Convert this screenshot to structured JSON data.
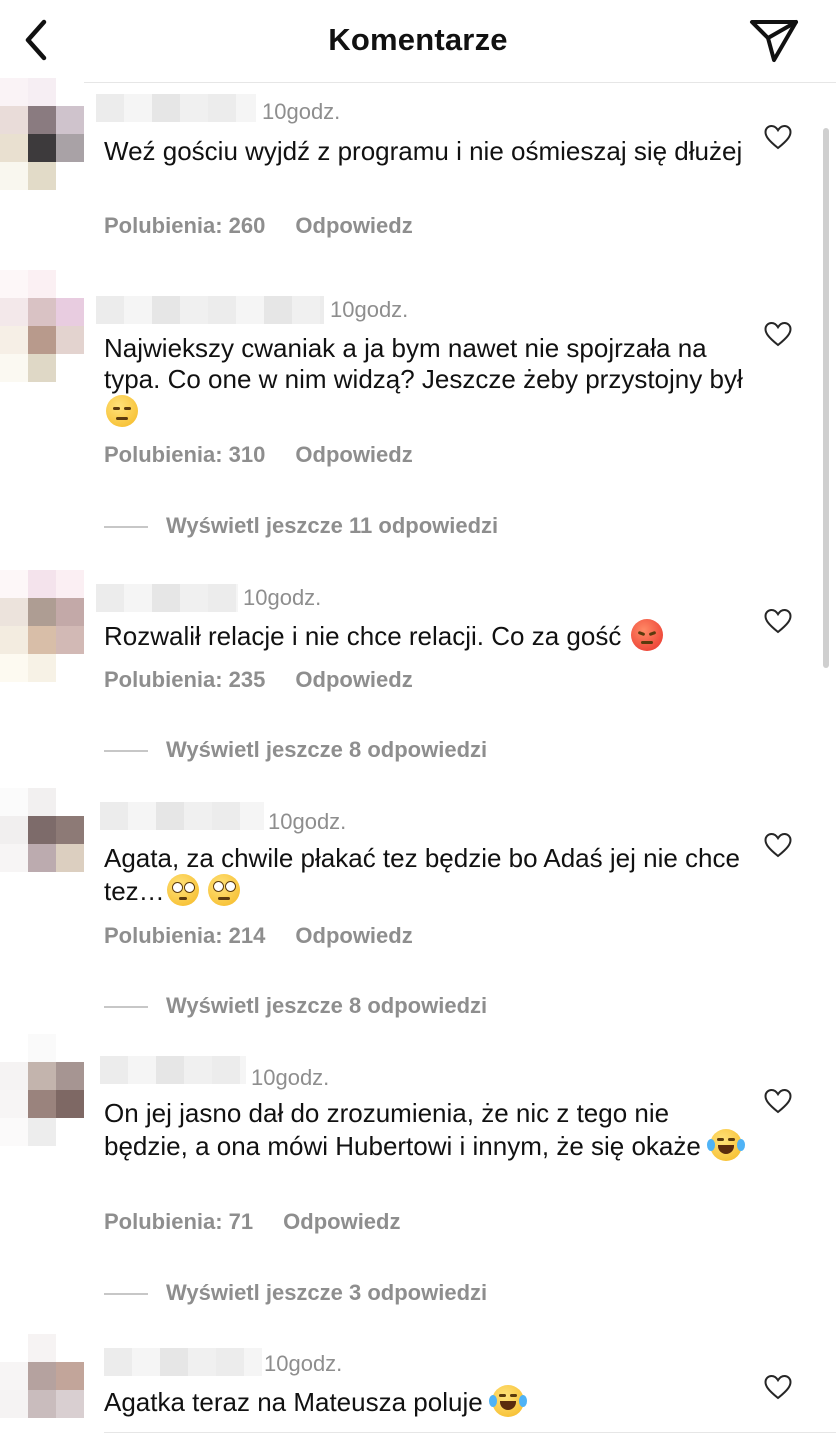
{
  "header": {
    "title": "Komentarze",
    "back_icon": "chevron-left-icon",
    "send_icon": "paper-plane-icon"
  },
  "comments": [
    {
      "time": "10godz.",
      "text": "Weź gościu wyjdź z programu i nie ośmieszaj się dłużej",
      "likes": "Polubienia: 260",
      "reply": "Odpowiedz"
    },
    {
      "time": "10godz.",
      "text": "Najwiekszy cwaniak a ja bym nawet nie spojrzała na typa. Co one w nim widzą? Jeszcze żeby przystojny był",
      "emoji": [
        "unamused-face"
      ],
      "likes": "Polubienia: 310",
      "reply": "Odpowiedz",
      "more_replies": "Wyświetl jeszcze 11 odpowiedzi"
    },
    {
      "time": "10godz.",
      "text": "Rozwalił relacje i nie chce relacji. Co za gość",
      "emoji": [
        "pouting-face"
      ],
      "likes": "Polubienia: 235",
      "reply": "Odpowiedz",
      "more_replies": "Wyświetl jeszcze 8 odpowiedzi"
    },
    {
      "time": "10godz.",
      "text": "Agata, za chwile płakać tez będzie bo Adaś jej nie chce tez…",
      "emoji": [
        "flushed-face",
        "face-with-rolling-eyes"
      ],
      "likes": "Polubienia: 214",
      "reply": "Odpowiedz",
      "more_replies": "Wyświetl jeszcze 8 odpowiedzi"
    },
    {
      "time": "10godz.",
      "text": "On jej jasno dał do zrozumienia, że nic z tego nie będzie, a ona mówi Hubertowi i innym, że się okaże",
      "emoji": [
        "face-with-tears-of-joy"
      ],
      "likes": "Polubienia: 71",
      "reply": "Odpowiedz",
      "more_replies": "Wyświetl jeszcze 3 odpowiedzi"
    },
    {
      "time": "10godz.",
      "text": "Agatka teraz na Mateusza poluje",
      "emoji": [
        "face-with-tears-of-joy"
      ]
    }
  ],
  "colors": {
    "text": "#111111",
    "secondary": "#8e8e8e",
    "divider": "#e6e6e6"
  }
}
